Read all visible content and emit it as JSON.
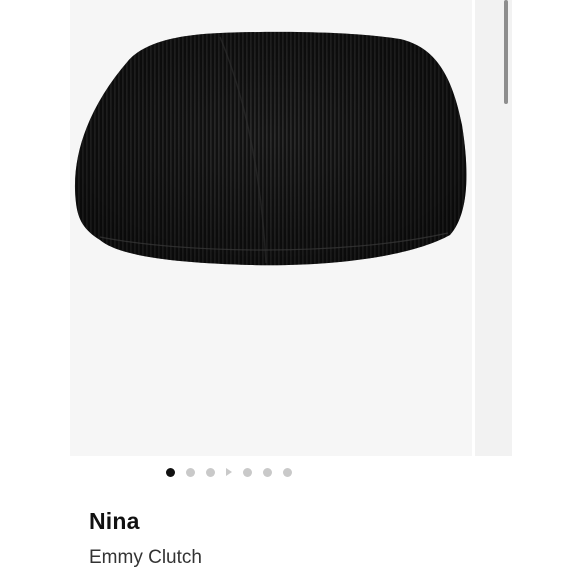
{
  "product": {
    "brand": "Nina",
    "name": "Emmy Clutch",
    "color": "#111111"
  },
  "gallery": {
    "total_images": 6,
    "active_index": 0,
    "icons": [
      "dot",
      "dot",
      "dot",
      "play-icon",
      "dot",
      "dot",
      "dot"
    ]
  },
  "colors": {
    "image_background": "#f6f6f6",
    "dot_active": "#111111",
    "dot_inactive": "#c9c9c9"
  }
}
